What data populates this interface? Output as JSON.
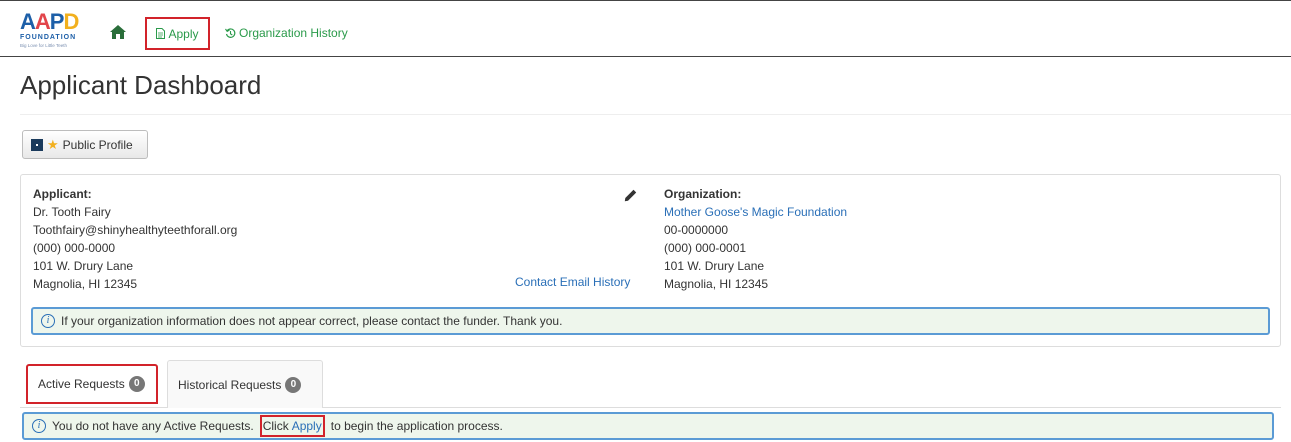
{
  "nav": {
    "logo_letters": [
      "A",
      "A",
      "P",
      "D"
    ],
    "logo_sub": "FOUNDATION",
    "logo_tagline": "Big Love for Little Teeth",
    "apply_label": "Apply",
    "history_label": "Organization History"
  },
  "page": {
    "title": "Applicant Dashboard"
  },
  "profile_button": {
    "label": "Public Profile"
  },
  "applicant": {
    "heading": "Applicant:",
    "name": "Dr. Tooth Fairy",
    "email": "Toothfairy@shinyhealthyteethforall.org",
    "phone": "(000) 000-0000",
    "address1": "101 W. Drury Lane",
    "address2": "Magnolia, HI 12345",
    "contact_history_link": "Contact Email History"
  },
  "organization": {
    "heading": "Organization:",
    "name": "Mother Goose's Magic Foundation",
    "ein": "00-0000000",
    "phone": "(000) 000-0001",
    "address1": "101 W. Drury Lane",
    "address2": "Magnolia, HI 12345"
  },
  "org_alert": {
    "text": "If your organization information does not appear correct, please contact the funder. Thank you."
  },
  "tabs": [
    {
      "label": "Active Requests",
      "count": "0"
    },
    {
      "label": "Historical Requests",
      "count": "0"
    }
  ],
  "requests_alert": {
    "text_before": "You do not have any Active Requests.",
    "click": "Click",
    "apply_link": "Apply",
    "text_after": "to begin the application process."
  },
  "colors": {
    "nav_green": "#2a9a4a",
    "link_blue": "#2a6fb7",
    "highlight_red": "#d2232a",
    "alert_border": "#5b9bd5",
    "alert_bg": "#eef6ec"
  }
}
